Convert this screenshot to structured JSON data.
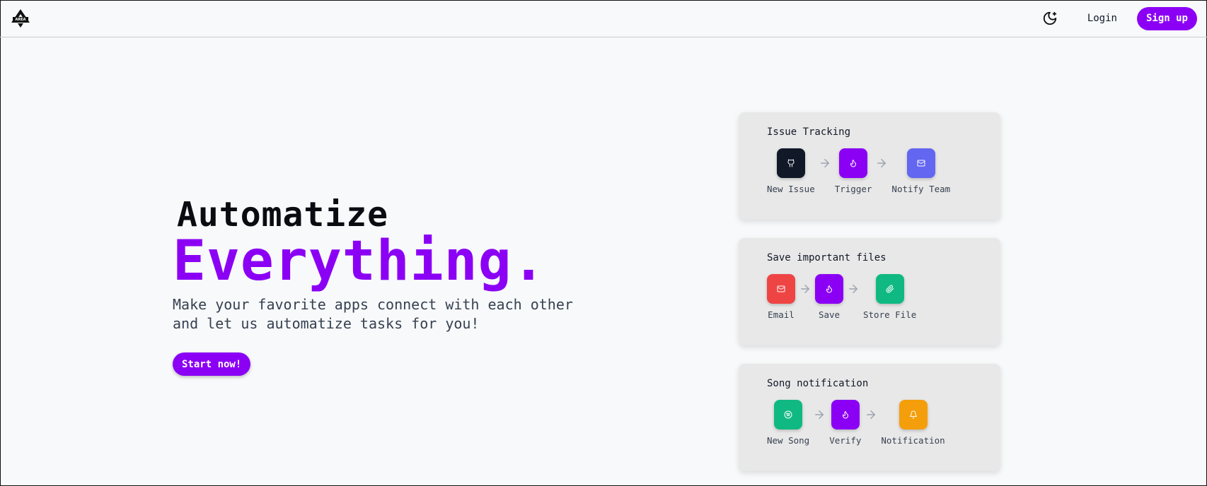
{
  "header": {
    "logo_alt": "AREA",
    "login_label": "Login",
    "signup_label": "Sign up"
  },
  "hero": {
    "line1": "Automatize",
    "line2": "Everything.",
    "subtitle": "Make your favorite apps connect with each other and let us automatize tasks for you!",
    "cta_label": "Start now!"
  },
  "cards": [
    {
      "title": "Issue Tracking",
      "steps": [
        {
          "label": "New Issue",
          "icon": "github-icon",
          "color": "#111827"
        },
        {
          "label": "Trigger",
          "icon": "flame-icon",
          "color": "#8b00f5"
        },
        {
          "label": "Notify Team",
          "icon": "mail-icon",
          "color": "#6366f1"
        }
      ]
    },
    {
      "title": "Save important files",
      "steps": [
        {
          "label": "Email",
          "icon": "mail-icon",
          "color": "#ef4444"
        },
        {
          "label": "Save",
          "icon": "flame-icon",
          "color": "#8b00f5"
        },
        {
          "label": "Store File",
          "icon": "paperclip-icon",
          "color": "#10b981"
        }
      ]
    },
    {
      "title": "Song notification",
      "steps": [
        {
          "label": "New Song",
          "icon": "spotify-icon",
          "color": "#10b981"
        },
        {
          "label": "Verify",
          "icon": "flame-icon",
          "color": "#8b00f5"
        },
        {
          "label": "Notification",
          "icon": "bell-icon",
          "color": "#f59e0b"
        }
      ]
    }
  ],
  "colors": {
    "accent": "#8b00f5",
    "background": "#f7f9fa",
    "card": "#e8e8e8"
  }
}
